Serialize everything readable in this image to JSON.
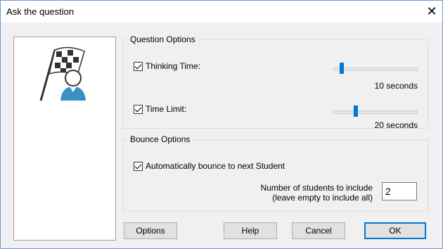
{
  "window": {
    "title": "Ask the question",
    "close_glyph": "✕"
  },
  "question_options": {
    "legend": "Question Options",
    "thinking_time": {
      "label": "Thinking Time:",
      "checked": true,
      "slider_fraction": 0.1,
      "value_text": "10 seconds"
    },
    "time_limit": {
      "label": "Time Limit:",
      "checked": true,
      "slider_fraction": 0.27,
      "value_text": "20 seconds"
    }
  },
  "bounce_options": {
    "legend": "Bounce Options",
    "auto_bounce": {
      "label": "Automatically bounce to next Student",
      "checked": true
    },
    "students_label_line1": "Number of students to include",
    "students_label_line2": "(leave empty to include all)",
    "students_value": "2"
  },
  "buttons": {
    "options": "Options",
    "help": "Help",
    "cancel": "Cancel",
    "ok": "OK"
  },
  "colors": {
    "accent": "#0078d7",
    "logo_person": "#3b8fc2"
  },
  "icons": {
    "logo": "checkered-flag-student-icon",
    "close": "close-icon"
  }
}
